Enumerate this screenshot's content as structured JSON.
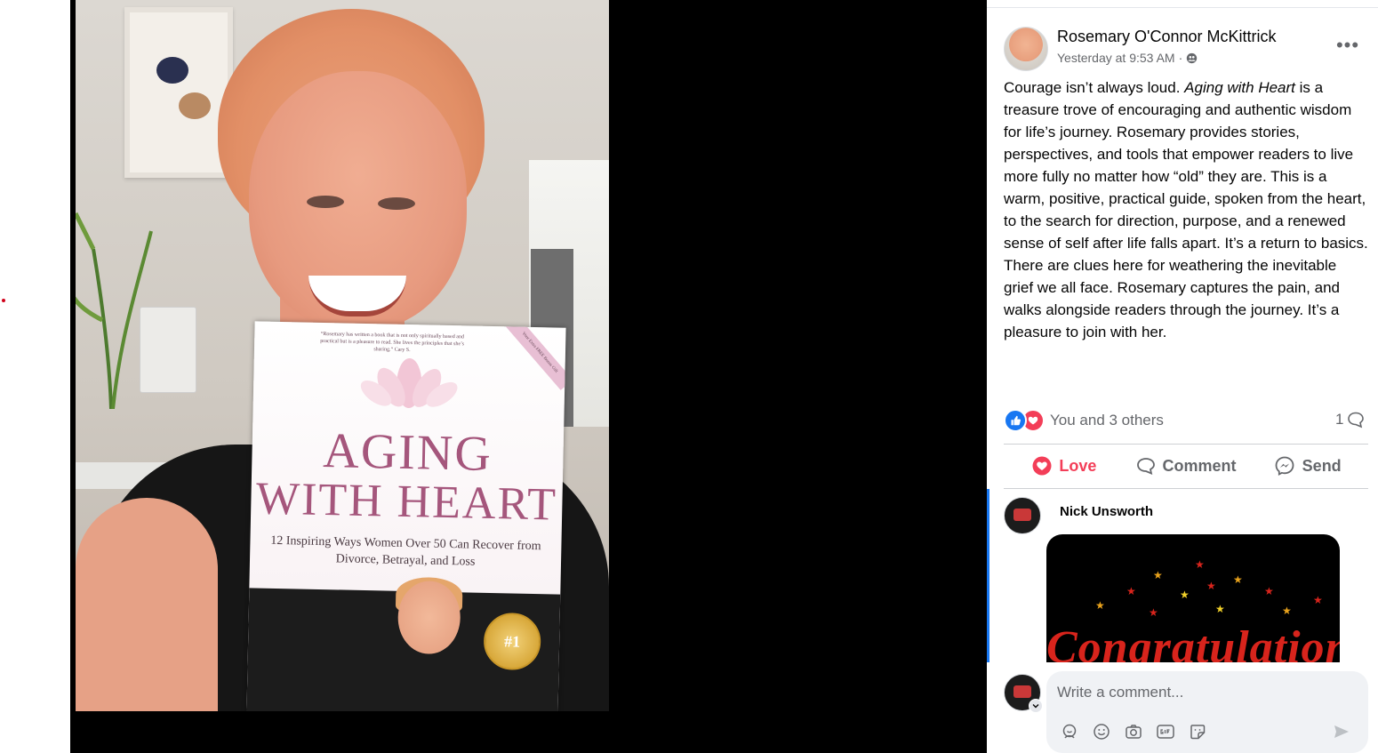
{
  "post": {
    "author": "Rosemary O'Connor McKittrick",
    "timestamp": "Yesterday at 9:53 AM",
    "separator": "·",
    "more_icon": "more-horizontal-icon",
    "body_parts": {
      "intro": "Courage isn’t always loud. ",
      "book_title": "Aging with Heart",
      "rest": " is a treasure trove of encouraging and authentic wisdom for life’s journey. Rosemary provides stories, perspectives, and tools that empower readers to live more fully no matter how “old” they are. This is a warm, positive, practical guide, spoken from the heart, to the search for direction, purpose, and a renewed sense of self after life falls apart. It’s a return to basics. There are clues here for weathering the inevitable grief we all face. Rosemary captures the pain, and walks alongside readers through the journey. It’s a pleasure to join with her."
    }
  },
  "photo": {
    "book": {
      "blurb": "“Rosemary has written a book that is not only spiritually based and practical but is a pleasure to read. She lives the principles that she’s sharing.” Cary S.",
      "corner_tag": "Your Extra FREE Bonus Gift",
      "title_line1": "AGING",
      "title_line2": "WITH HEART",
      "subtitle": "12 Inspiring Ways Women Over 50 Can Recover from Divorce, Betrayal, and Loss",
      "seal": "#1"
    }
  },
  "reactions": {
    "summary": "You and 3 others",
    "comment_count": "1"
  },
  "actions": {
    "love": "Love",
    "comment": "Comment",
    "send": "Send"
  },
  "comments": [
    {
      "name": "Nick Unsworth",
      "gif_text": "Congratulations"
    }
  ],
  "composer": {
    "placeholder": "Write a comment..."
  },
  "colors": {
    "facebook_blue": "#1877f2",
    "love_red": "#f33e58",
    "secondary_text": "#65676b",
    "book_title_pink": "#a5567c"
  }
}
